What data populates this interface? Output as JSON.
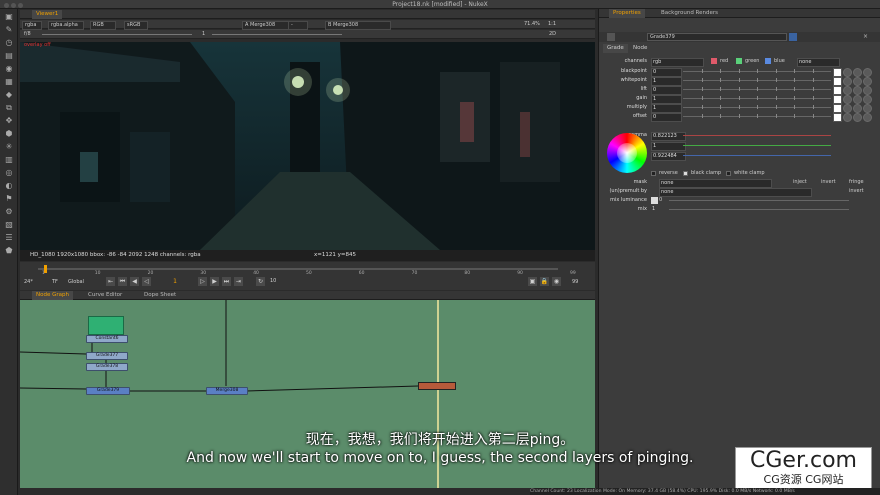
{
  "window": {
    "title": "Project18.nk [modified] - NukeX"
  },
  "viewer": {
    "tab": "Viewer1",
    "controls": {
      "channels": "rgba",
      "alpha": "rgba.alpha",
      "colorspace": "RGB",
      "lut": "sRGB",
      "a_input": "A Merge308",
      "b_input": "B Merge308",
      "frame": "1",
      "gain_label": "f/8",
      "one": "1",
      "mode_2d": "2D",
      "zoom": "71.4%",
      "ratio": "1:1"
    },
    "overlay_text": "overlay off",
    "status_format": "HD_1080 1920x1080  bbox: -86 -84 2092 1248 channels: rgba",
    "status_coords": "x=1121 y=845"
  },
  "timeline": {
    "ticks": [
      "1",
      "10",
      "20",
      "30",
      "40",
      "50",
      "60",
      "70",
      "80",
      "90",
      "99"
    ],
    "start": "1",
    "end": "99",
    "fps": "24*",
    "tf": "TF",
    "scope": "Global",
    "step": "10",
    "frame_field": "1"
  },
  "panels": {
    "tabs": [
      "Node Graph",
      "Curve Editor",
      "Dope Sheet"
    ]
  },
  "nodes": [
    {
      "label": "Constant6"
    },
    {
      "label": "Grade377"
    },
    {
      "label": "Grade378"
    },
    {
      "label": "Grade379"
    },
    {
      "label": "Merge308"
    }
  ],
  "properties": {
    "tabs": [
      "Properties",
      "Background Renders"
    ],
    "node_name": "Grade379",
    "sub_tabs": [
      "Grade",
      "Node"
    ],
    "channels": {
      "label": "channels",
      "value": "rgb",
      "checks": [
        "red",
        "green",
        "blue"
      ],
      "extra": "none"
    },
    "rows": [
      {
        "label": "blackpoint",
        "value": "0"
      },
      {
        "label": "whitepoint",
        "value": "1"
      },
      {
        "label": "lift",
        "value": "0"
      },
      {
        "label": "gain",
        "value": "1"
      },
      {
        "label": "multiply",
        "value": "1"
      },
      {
        "label": "offset",
        "value": "0"
      }
    ],
    "gamma": {
      "label": "gamma",
      "values": [
        "0.822123",
        "1",
        "0.922484"
      ]
    },
    "options": [
      "reverse",
      "black clamp",
      "white clamp"
    ],
    "mask": {
      "label": "mask",
      "value": "none",
      "inject": "inject",
      "invert": "invert",
      "fringe": "fringe"
    },
    "unpremult": {
      "label": "(un)premult by",
      "value": "none",
      "invert": "invert"
    },
    "mix_luminance": {
      "label": "mix luminance",
      "value": "0"
    },
    "mix": {
      "label": "mix",
      "value": "1"
    }
  },
  "subtitles": {
    "chinese": "现在，我想，我们将开始进入第二层ping。",
    "english": "And now we'll start to move on to, I guess, the second layers of pinging."
  },
  "footer": "Channel Count: 23  Localization Mode: On  Memory: 37.4 GB (58.4%)  CPU: 195.9%  Disk: 0.0 MB/s  Network: 0.0 MB/s",
  "watermark": {
    "main": "CGer.com",
    "sub": "CG资源 CG网站"
  },
  "colors": {
    "accent": "#f0a000",
    "nodegraph_bg": "#5b8c6a",
    "grade_node": "#8fa8c9"
  }
}
